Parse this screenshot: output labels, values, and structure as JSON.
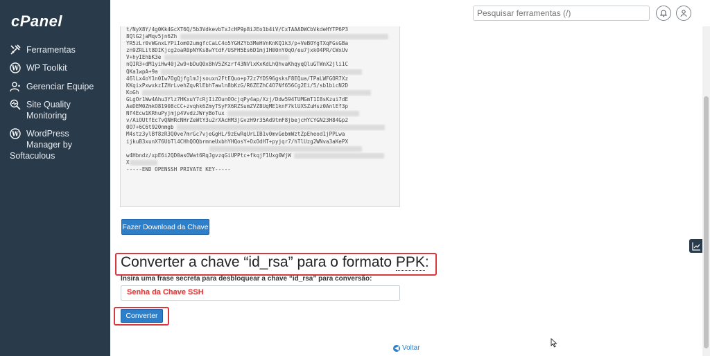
{
  "sidebar": {
    "logo": "cPanel",
    "items": [
      {
        "label": "Ferramentas",
        "icon": "tools-icon"
      },
      {
        "label": "WP Toolkit",
        "icon": "wordpress-icon"
      },
      {
        "label": "Gerenciar Equipe",
        "icon": "users-icon"
      },
      {
        "label_line1": "Site Quality",
        "label_line2": "Monitoring",
        "icon": "pulse-icon"
      },
      {
        "label_line1": "WordPress",
        "label_line2": "Manager by",
        "label_line3": "Softaculous",
        "icon": "wordpress-icon"
      }
    ]
  },
  "topbar": {
    "search_placeholder": "Pesquisar ferramentas (/)",
    "bell_icon": "bell-icon",
    "user_icon": "user-icon"
  },
  "key": {
    "lines": [
      "t/NyX8Y/4g0Kk4GcXT6Q/5b3VdkevbTxJcHP9p8iJEo1b4iV/CxTAAADWCbVkdeHYTP6P3",
      "8QlG2jaMqv5jn6Zh",
      "YR5zLr0vWGnxLYPiIom02umgfcCaLC4o5YGHZYb3MeHVnKnKQ1k3/p+VeBOYgTXqFGsGBa",
      "zn9ZRLit8DIKjcg2oaR0pNYKs8wYtdF/USFH5Es6D1mjIH00nY0qO/eu7jxkO4PR/CWxUv",
      "V+hyIEhbK3e",
      "nQIR3+dM1yiHw40j2w9+bDuQ0x8hV5ZKzrf43NVlxKxKdLhQhvaKhqyqQluGTWnX2jli1C",
      "QKa1wpA+9a",
      "46lLx4oY1n0Iw7OgQjfglmJjsouxn2FtEQuo+p72z7YDS96gsksF8EQua/TPaLWFGOR7Xz",
      "KKqixPxwxkzIZHrLvehZqvRlEbhTawln8bKzG/R6ZEZhC4O7Nf656Cg2Ei/5/sb1bicN2D",
      "KoGh",
      "GLgOr1Ww4Ahu3Ylz7HKxuY7cRjIiZOunOOcjqPy4ap/Xzj/Ddw594TUMGmT1I8sKzui7dE",
      "AeDEM0ZmkO81908cCC+zvqhk6ZmyTSyFX6RZSumZVZ8UqME1knF7klUXSZuHsz0AnlEf3p",
      "Nf4Ecw1KRhuPyjmjp4VvdzJWryBoTux",
      "v/AiOUtfEc7vQNHRcNHrZeWtY3u2rXAcHM3jGvzH9r35Ad9tmF8jbejcHYCYGN23H84Gp2",
      "0O7+6C6t920nmgb",
      "M4stz3ylBf8zR3Q0ve7mrGc7vjeGgHL/9zEwRqUrLIB1v0mvGebmWztZpEheod1jPPLwa",
      "ijkuB3xunX76UbTl4CHhQOQbrmneUxbhYHQosY+OxOdHT+pyjqr7/hTlUzg2WNva3aKePX",
      "",
      "w4Hbndz/xpE6i2QD0asOWat6RqJgvzqGiUPPtc+fkqjF1Uxg0WjW",
      "X",
      "-----END OPENSSH PRIVATE KEY-----"
    ]
  },
  "download_button": "Fazer Download da Chave",
  "convert_section": {
    "heading_part1": "Converter a chave “id_rsa” para o formato ",
    "heading_abbr": "PPK",
    "heading_colon": ":",
    "label_part1": "Insira uma frase secreta para desbloquear a chave ",
    "label_key": "“id_rsa”",
    "label_part2": " para conversão:",
    "input_value": "Senha da Chave SSH",
    "button": "Converter"
  },
  "back_link": "Voltar",
  "colors": {
    "sidebar_bg": "#293a4a",
    "primary_button": "#2e7fc9",
    "highlight_red": "#d9363e"
  }
}
